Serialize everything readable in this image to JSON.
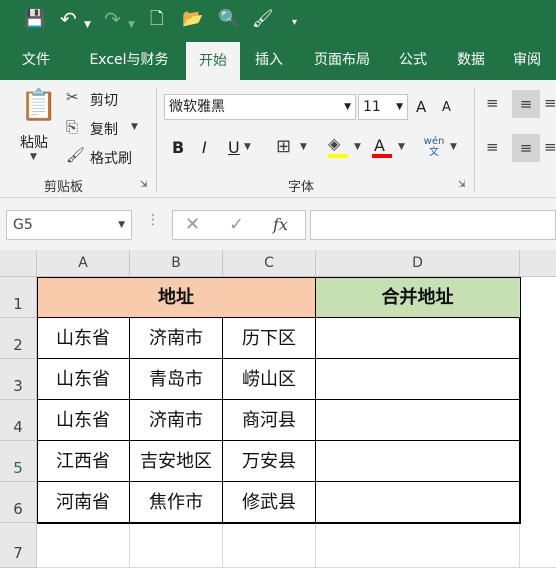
{
  "qat": {
    "icons": [
      "save-icon",
      "undo-icon",
      "redo-icon",
      "new-file-icon",
      "open-folder-icon",
      "print-preview-icon",
      "format-painter-qat-icon",
      "customize-qat-icon"
    ]
  },
  "tabs": [
    {
      "label": "文件"
    },
    {
      "label": "Excel与财务"
    },
    {
      "label": "开始"
    },
    {
      "label": "插入"
    },
    {
      "label": "页面布局"
    },
    {
      "label": "公式"
    },
    {
      "label": "数据"
    },
    {
      "label": "审阅"
    }
  ],
  "ribbon": {
    "clipboard": {
      "paste": "粘贴",
      "cut": "剪切",
      "copy": "复制",
      "format_painter": "格式刷",
      "group_label": "剪贴板"
    },
    "font": {
      "font_name": "微软雅黑",
      "font_size": "11",
      "group_label": "字体",
      "bold": "B",
      "italic": "I",
      "underline": "U",
      "font_color_glyph": "A",
      "phonetic": "wén 文",
      "grow": "A",
      "shrink": "A"
    },
    "colors": {
      "accent": "#217346",
      "fill_highlight": "#ffff00",
      "font_red": "#ff0000"
    }
  },
  "formula_bar": {
    "name_box": "G5",
    "fx": "fx",
    "value": ""
  },
  "columns": [
    "A",
    "B",
    "C",
    "D"
  ],
  "rows": [
    "1",
    "2",
    "3",
    "4",
    "5",
    "6",
    "7"
  ],
  "sheet": {
    "header_address": "地址",
    "header_merged": "合并地址",
    "header_address_color": "#f8cbad",
    "header_merged_color": "#c6e0b4",
    "data": [
      [
        "山东省",
        "济南市",
        "历下区",
        ""
      ],
      [
        "山东省",
        "青岛市",
        "崂山区",
        ""
      ],
      [
        "山东省",
        "济南市",
        "商河县",
        ""
      ],
      [
        "江西省",
        "吉安地区",
        "万安县",
        ""
      ],
      [
        "河南省",
        "焦作市",
        "修武县",
        ""
      ]
    ]
  }
}
